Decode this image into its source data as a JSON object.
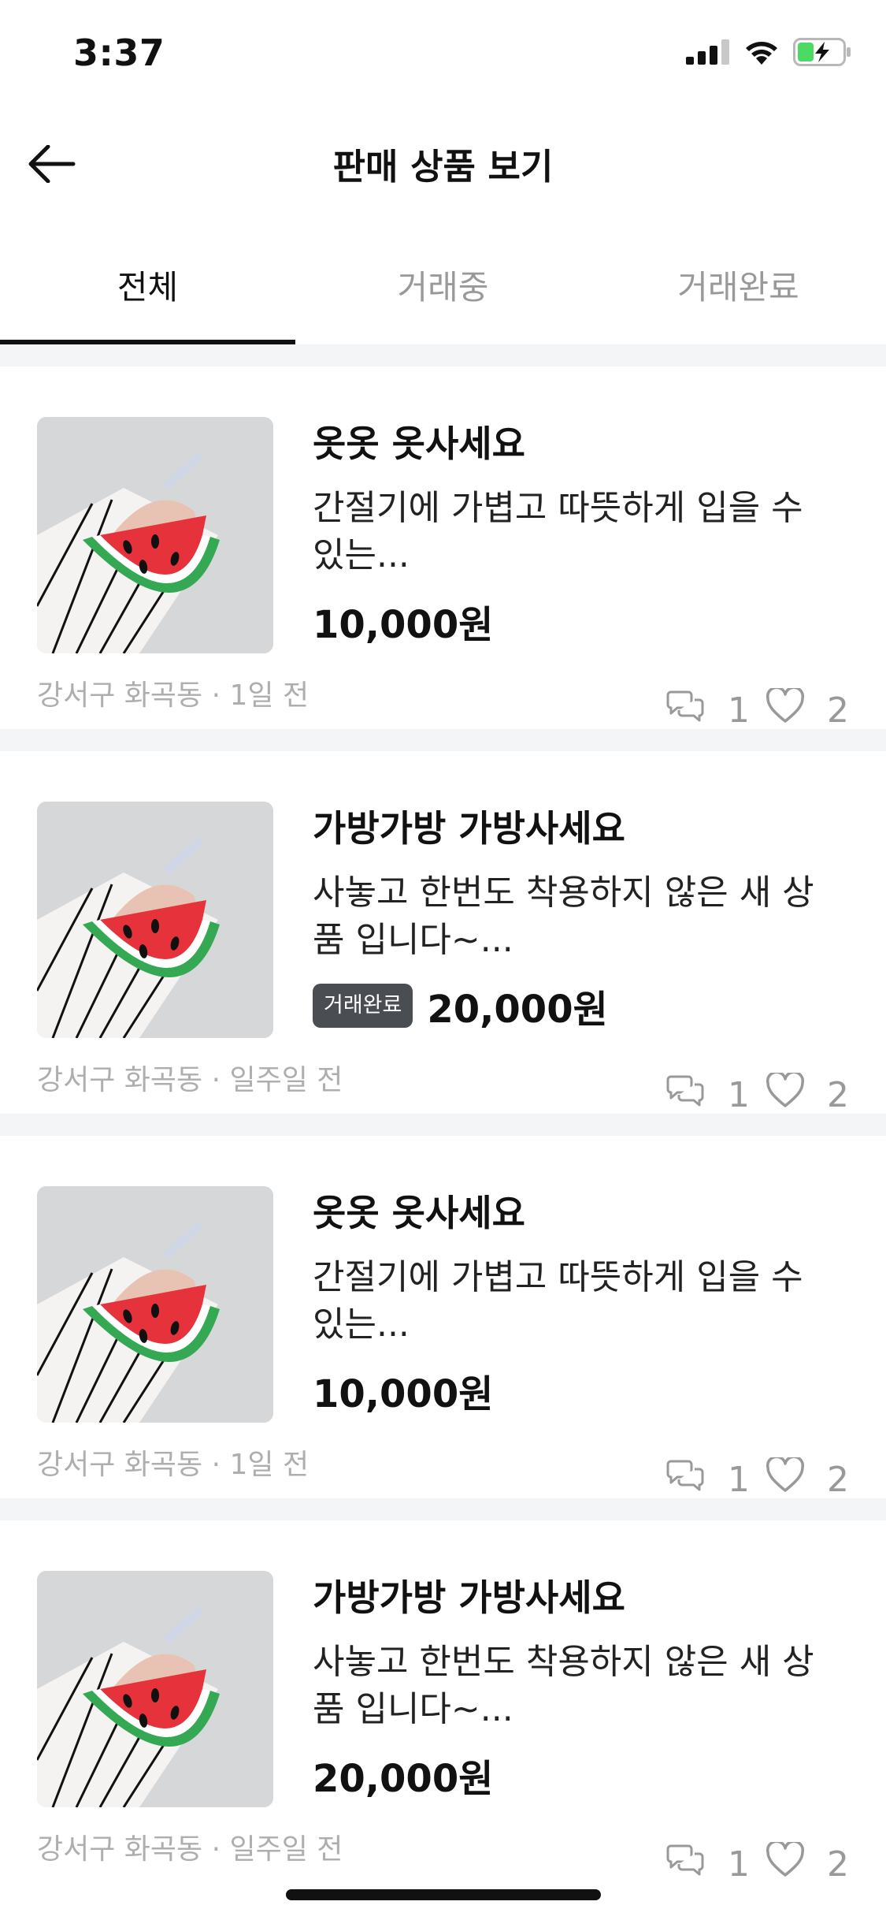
{
  "status_bar": {
    "time": "3:37"
  },
  "header": {
    "title": "판매 상품 보기"
  },
  "tabs": [
    {
      "label": "전체",
      "active": true
    },
    {
      "label": "거래중",
      "active": false
    },
    {
      "label": "거래완료",
      "active": false
    }
  ],
  "items": [
    {
      "title": "옷옷 옷사세요",
      "description": "간절기에 가볍고 따뜻하게 입을 수 있는...",
      "badge": "",
      "price": "10,000원",
      "meta": "강서구 화곡동 · 1일 전",
      "chat_count": "1",
      "like_count": "2"
    },
    {
      "title": "가방가방 가방사세요",
      "description": "사놓고 한번도 착용하지 않은 새 상품 입니다~...",
      "badge": "거래완료",
      "price": "20,000원",
      "meta": "강서구 화곡동 · 일주일 전",
      "chat_count": "1",
      "like_count": "2"
    },
    {
      "title": "옷옷 옷사세요",
      "description": "간절기에 가볍고 따뜻하게 입을 수 있는...",
      "badge": "",
      "price": "10,000원",
      "meta": "강서구 화곡동 · 1일 전",
      "chat_count": "1",
      "like_count": "2"
    },
    {
      "title": "가방가방 가방사세요",
      "description": "사놓고 한번도 착용하지 않은 새 상품 입니다~...",
      "badge": "",
      "price": "20,000원",
      "meta": "강서구 화곡동 · 일주일 전",
      "chat_count": "1",
      "like_count": "2"
    }
  ],
  "icons": {
    "back": "arrow-left-icon",
    "chat": "chat-bubbles-icon",
    "like": "heart-outline-icon",
    "signal": "cellular-signal-icon",
    "wifi": "wifi-icon",
    "battery": "battery-charging-icon"
  },
  "colors": {
    "text_primary": "#111111",
    "text_secondary": "#999999",
    "badge_bg": "#4a4d51",
    "battery_green": "#4cd964",
    "separator": "#f4f5f6"
  }
}
